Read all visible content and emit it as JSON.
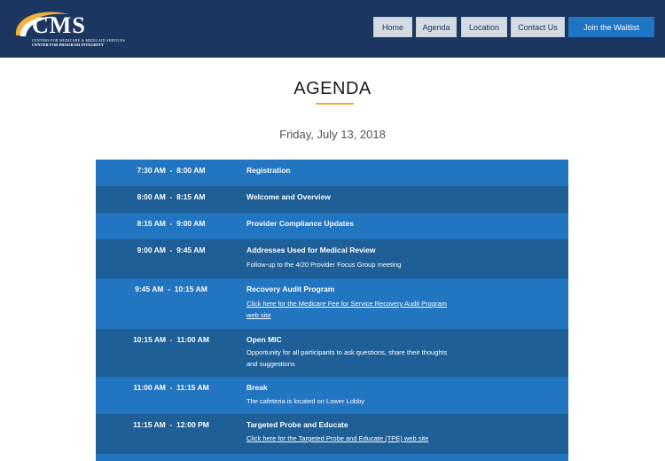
{
  "header": {
    "logo_text": "CMS",
    "logo_tagline": "CENTERS FOR MEDICARE & MEDICAID SERVICES",
    "logo_subtitle": "CENTER FOR PROGRAM INTEGRITY",
    "nav": {
      "home": "Home",
      "agenda": "Agenda",
      "location": "Location",
      "contact": "Contact Us"
    },
    "cta": "Join the Waitlist"
  },
  "page": {
    "heading": "AGENDA",
    "date": "Friday, July 13, 2018"
  },
  "agenda": [
    {
      "time": "7:30 AM  -  8:00 AM",
      "title": "Registration"
    },
    {
      "time": "8:00 AM  -  8:15 AM",
      "title": "Welcome and Overview"
    },
    {
      "time": "8:15 AM  -  9:00 AM",
      "title": "Provider Compliance Updates"
    },
    {
      "time": "9:00 AM  -  9:45 AM",
      "title": "Addresses Used for Medical Review",
      "description": "Follow-up to the 4/20 Provider Focus Group meeting"
    },
    {
      "time": "9:45 AM  -  10:15 AM",
      "title": "Recovery Audit Program",
      "link": "Click here for the Medicare Fee for Service Recovery Audit Program web site"
    },
    {
      "time": "10:15 AM  -  11:00 AM",
      "title": "Open MIC",
      "description": "Opportunity for all participants to ask questions, share their thoughts and suggestions"
    },
    {
      "time": "11:00 AM  -  11:15 AM",
      "title": "Break",
      "description": "The cafeteria is located on Lower Lobby"
    },
    {
      "time": "11:15 AM  -  12:00 PM",
      "title": "Targeted Probe and Educate",
      "link": "Click here for the Targeted Probe and Educate (TPE) web site"
    }
  ],
  "colors": {
    "header_bg": "#1b3660",
    "row_light": "#2275c0",
    "row_dark": "#1d5f96",
    "accent": "#f0a64a",
    "cta_bg": "#1f74c4"
  }
}
